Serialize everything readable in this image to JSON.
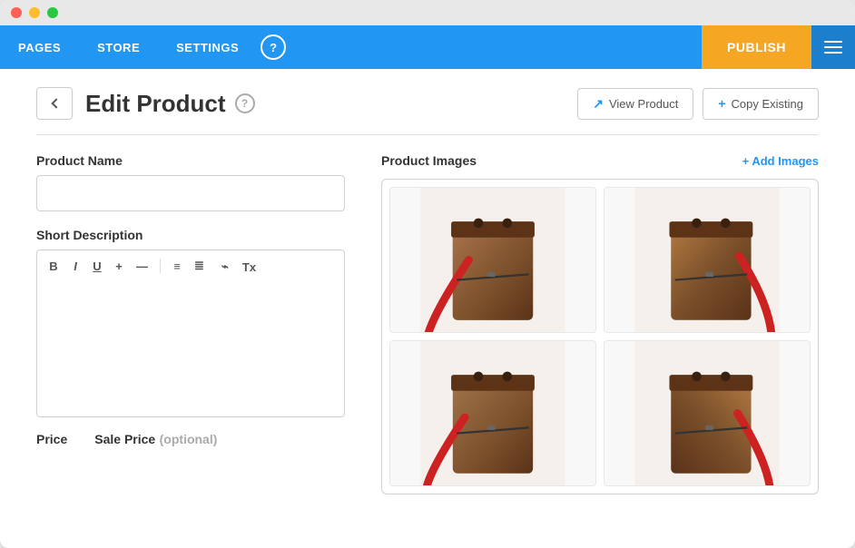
{
  "window": {
    "title": "Edit Product"
  },
  "titlebar": {
    "dots": [
      "red",
      "yellow",
      "green"
    ]
  },
  "navbar": {
    "items": [
      {
        "id": "pages",
        "label": "PAGES"
      },
      {
        "id": "store",
        "label": "STORE"
      },
      {
        "id": "settings",
        "label": "SETTINGS"
      }
    ],
    "help_label": "?",
    "publish_label": "PUBLISH"
  },
  "header": {
    "title": "Edit Product",
    "help": "?",
    "view_product_label": "View Product",
    "copy_existing_label": "Copy Existing",
    "view_icon": "↗",
    "copy_icon": "+"
  },
  "form": {
    "product_name_label": "Product Name",
    "product_name_placeholder": "",
    "short_description_label": "Short Description",
    "short_description_value": "",
    "price_label": "Price",
    "sale_price_label": "Sale Price",
    "sale_price_optional": "(optional)"
  },
  "toolbar": {
    "bold": "B",
    "italic": "I",
    "underline": "U",
    "plus": "+",
    "minus": "—",
    "list_ul": "≡",
    "list_ol": "≣",
    "link": "⌁",
    "clear": "Tx"
  },
  "images": {
    "label": "Product Images",
    "add_label": "+ Add Images",
    "grid": [
      {
        "id": "img1",
        "alt": "Product bag front view"
      },
      {
        "id": "img2",
        "alt": "Product bag side view"
      },
      {
        "id": "img3",
        "alt": "Product bag angle view"
      },
      {
        "id": "img4",
        "alt": "Product bag back view"
      }
    ]
  },
  "colors": {
    "blue": "#2196f3",
    "orange": "#f5a623",
    "border": "#d0d0d0"
  }
}
